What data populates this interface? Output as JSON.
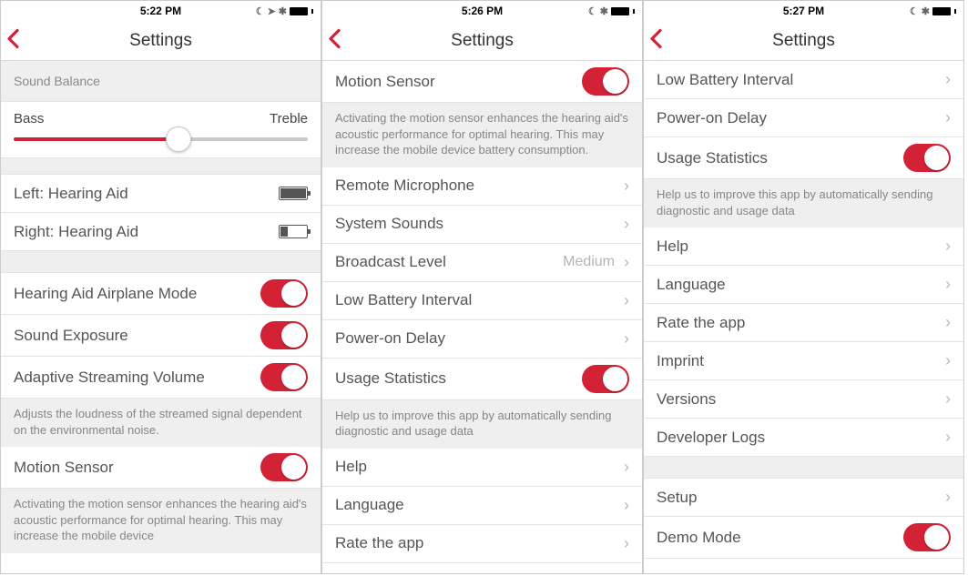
{
  "screens": [
    {
      "status": {
        "time": "5:22 PM",
        "icons": "moon-loc-bt-batt"
      },
      "nav": {
        "title": "Settings"
      },
      "soundBalance": {
        "header": "Sound Balance",
        "leftLabel": "Bass",
        "rightLabel": "Treble"
      },
      "devices": {
        "left": {
          "label": "Left: Hearing Aid",
          "battery": "full"
        },
        "right": {
          "label": "Right: Hearing Aid",
          "battery": "low"
        }
      },
      "toggles": {
        "airplane": {
          "label": "Hearing Aid Airplane Mode",
          "on": true
        },
        "exposure": {
          "label": "Sound Exposure",
          "on": true
        },
        "adaptive": {
          "label": "Adaptive Streaming Volume",
          "on": true
        }
      },
      "adaptiveFooter": "Adjusts the loudness of the streamed signal dependent on the environmental noise.",
      "motion": {
        "label": "Motion Sensor",
        "on": true
      },
      "motionFooter": "Activating the motion sensor enhances the hearing aid's acoustic performance for optimal hearing. This may increase the mobile device"
    },
    {
      "status": {
        "time": "5:26 PM",
        "icons": "moon-bt-batt"
      },
      "nav": {
        "title": "Settings"
      },
      "motion": {
        "label": "Motion Sensor",
        "on": true
      },
      "motionFooter": "Activating the motion sensor enhances the hearing aid's acoustic performance for optimal hearing. This may increase the mobile device battery consumption.",
      "rows": {
        "remoteMic": "Remote Microphone",
        "systemSounds": "System Sounds",
        "broadcast": {
          "label": "Broadcast Level",
          "value": "Medium"
        },
        "lowBattery": "Low Battery Interval",
        "powerOn": "Power-on Delay"
      },
      "usage": {
        "label": "Usage Statistics",
        "on": true
      },
      "usageFooter": "Help us to improve this app by automatically sending diagnostic and usage data",
      "links": {
        "help": "Help",
        "language": "Language",
        "rate": "Rate the app"
      }
    },
    {
      "status": {
        "time": "5:27 PM",
        "icons": "moon-bt-batt"
      },
      "nav": {
        "title": "Settings"
      },
      "rows1": {
        "lowBattery": "Low Battery Interval",
        "powerOn": "Power-on Delay"
      },
      "usage": {
        "label": "Usage Statistics",
        "on": true
      },
      "usageFooter": "Help us to improve this app by automatically sending diagnostic and usage data",
      "links": {
        "help": "Help",
        "language": "Language",
        "rate": "Rate the app",
        "imprint": "Imprint",
        "versions": "Versions",
        "devLogs": "Developer Logs"
      },
      "setup": "Setup",
      "demo": {
        "label": "Demo Mode",
        "on": true
      }
    }
  ]
}
